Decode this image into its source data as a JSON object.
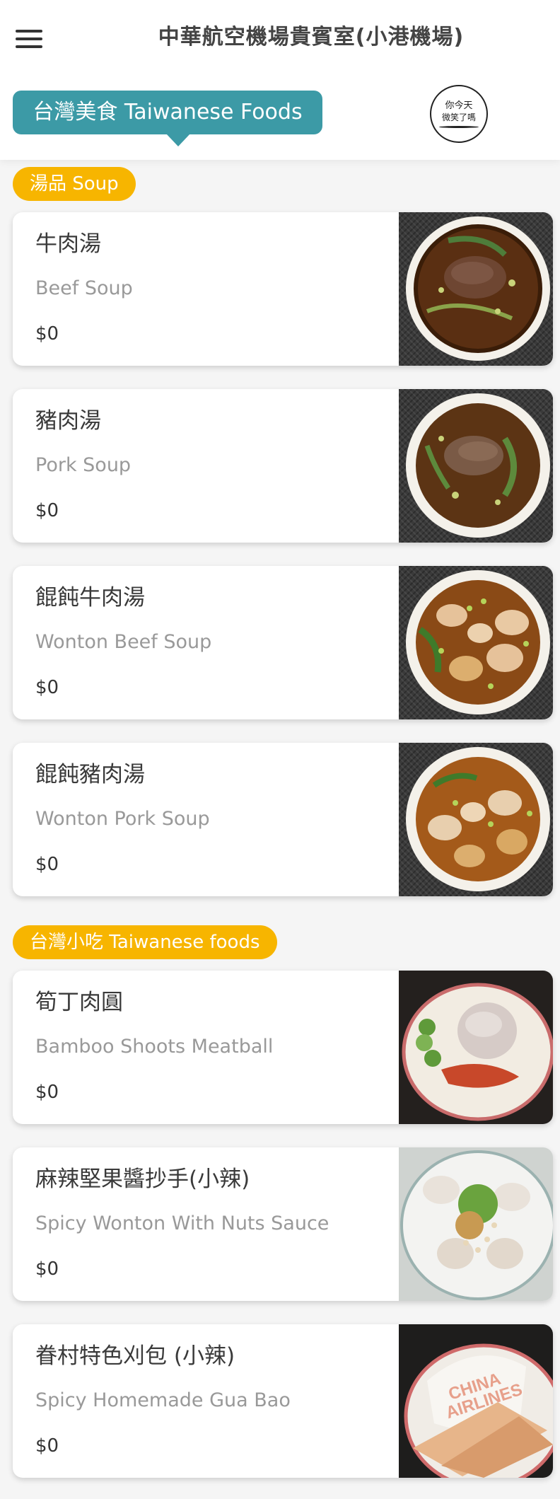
{
  "header": {
    "title": "中華航空機場貴賓室(小港機場)",
    "category_tab": "台灣美食 Taiwanese Foods",
    "menu_icon": "hamburger-menu-icon",
    "logo": {
      "line1": "你今天",
      "line2": "微笑了嗎"
    }
  },
  "sections": [
    {
      "label": "湯品 Soup",
      "items": [
        {
          "name": "牛肉湯",
          "en": "Beef Soup",
          "price": "$0"
        },
        {
          "name": "豬肉湯",
          "en": "Pork Soup",
          "price": "$0"
        },
        {
          "name": "餛飩牛肉湯",
          "en": "Wonton Beef Soup",
          "price": "$0"
        },
        {
          "name": "餛飩豬肉湯",
          "en": "Wonton Pork Soup",
          "price": "$0"
        }
      ]
    },
    {
      "label": "台灣小吃 Taiwanese foods",
      "items": [
        {
          "name": "筍丁肉圓",
          "en": "Bamboo Shoots Meatball",
          "price": "$0"
        },
        {
          "name": "麻辣堅果醬抄手(小辣)",
          "en": "Spicy Wonton With Nuts Sauce",
          "price": "$0"
        },
        {
          "name": "眷村特色刈包 (小辣)",
          "en": "Spicy Homemade Gua Bao",
          "price": "$0"
        }
      ]
    }
  ],
  "colors": {
    "accent": "#3c9aa6",
    "section_label": "#f7b500",
    "background": "#f5f5f5"
  }
}
